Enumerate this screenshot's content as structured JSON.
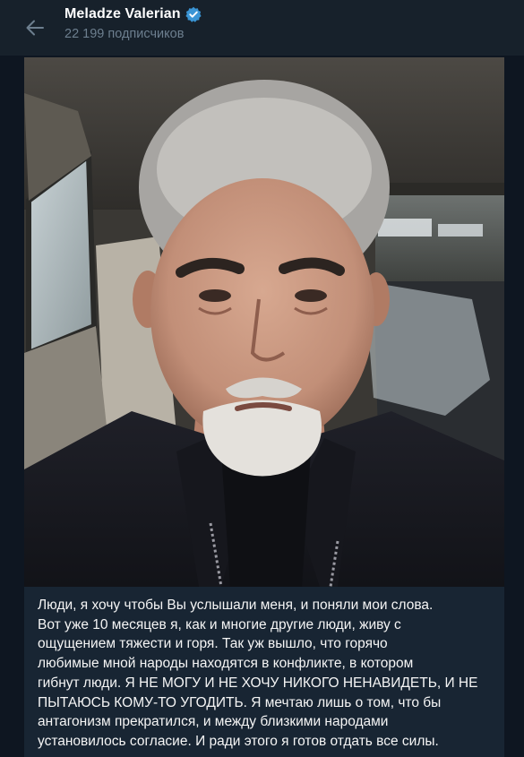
{
  "header": {
    "channel_name": "Meladze Valerian",
    "subscribers": "22 199 подписчиков",
    "back_icon": "arrow-left-icon",
    "verified_icon": "verified-badge-icon"
  },
  "colors": {
    "background": "#0e1621",
    "header": "#17212b",
    "post_bubble": "#182533",
    "accent": "#3a95d5",
    "muted_text": "#6d7f8f"
  },
  "post": {
    "text": "Люди, я хочу чтобы Вы услышали меня, и поняли мои слова.\nВот уже 10 месяцев я, как и многие другие люди, живу с\nощущением тяжести и горя. Так уж вышло, что горячо\nлюбимые мной народы находятся в конфликте, в котором\nгибнут люди. Я НЕ МОГУ И НЕ ХОЧУ НИКОГО НЕНАВИДЕТЬ, И НЕ\nПЫТАЮСЬ КОМУ-ТО УГОДИТЬ. Я мечтаю лишь о том, что бы\nантагонизм прекратился, и  между близкими народами\nустановилось согласие. И ради этого я готов отдать все силы."
  }
}
